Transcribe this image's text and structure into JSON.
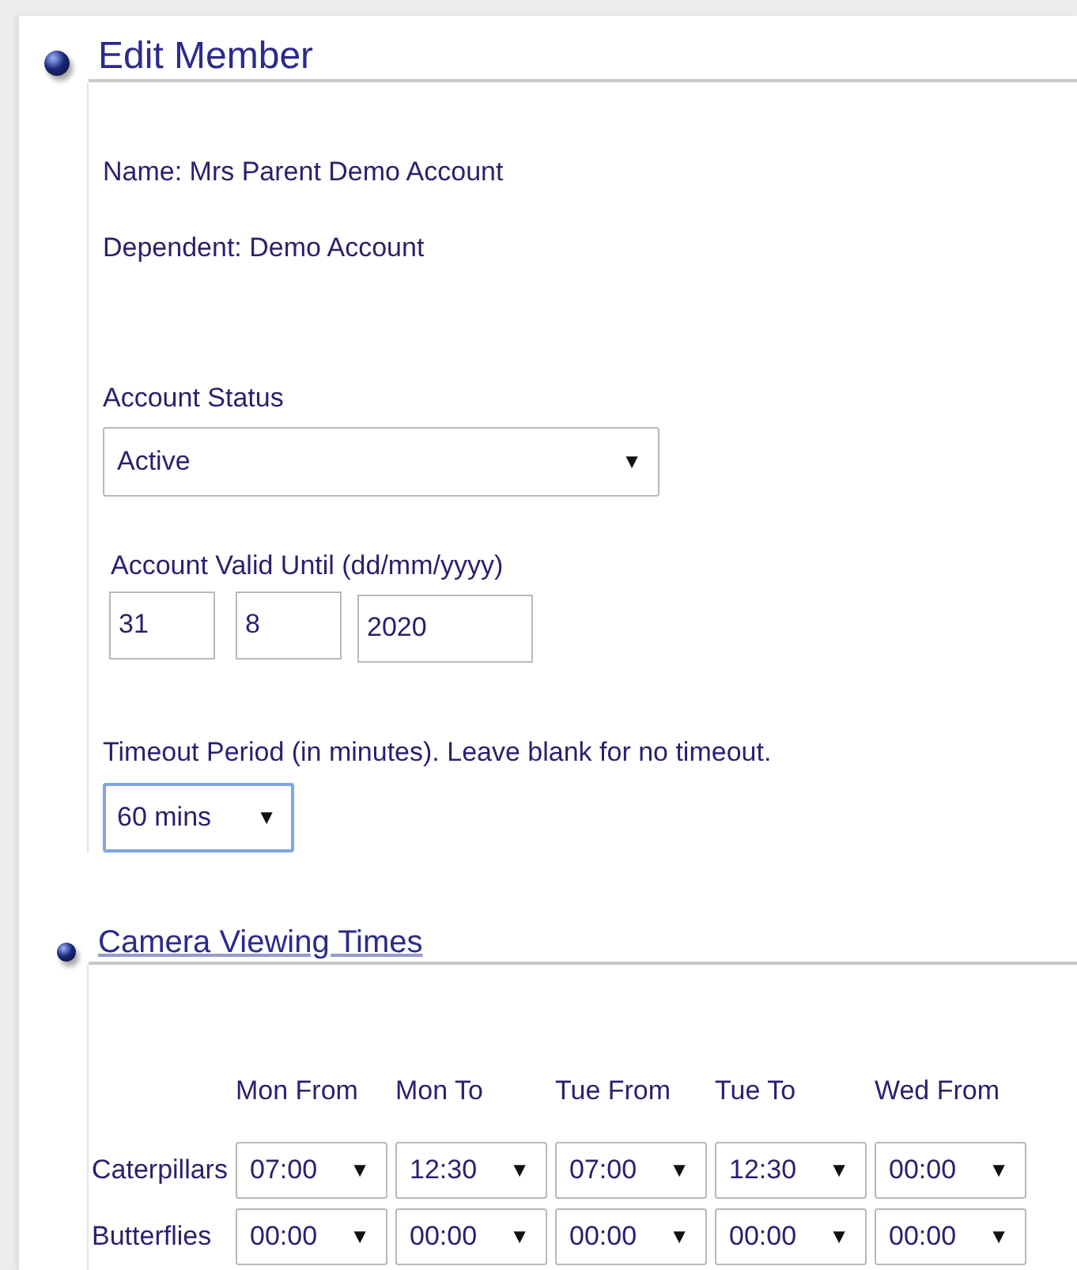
{
  "sections": [
    {
      "title": "Edit Member"
    },
    {
      "title": "Camera Viewing Times"
    }
  ],
  "member": {
    "name": "Name: Mrs Parent Demo Account",
    "dependent": "Dependent: Demo Account"
  },
  "account_status": {
    "label": "Account Status",
    "value": "Active",
    "caret": "▼",
    "focused": false
  },
  "valid_until": {
    "label": "Account Valid Until (dd/mm/yyyy)",
    "day": "31",
    "month": "8",
    "year": "2020"
  },
  "timeout": {
    "label": "Timeout Period (in minutes). Leave blank for no timeout.",
    "value": "60 mins",
    "caret": "▼",
    "focused": true
  },
  "times_table": {
    "columns": [
      "Mon From",
      "Mon To",
      "Tue From",
      "Tue To",
      "Wed From"
    ],
    "rows": [
      {
        "room": "Caterpillars",
        "values": [
          "07:00",
          "12:30",
          "07:00",
          "12:30",
          "00:00"
        ]
      },
      {
        "room": "Butterflies",
        "values": [
          "00:00",
          "00:00",
          "00:00",
          "00:00",
          "00:00"
        ]
      }
    ],
    "caret": "▼"
  }
}
